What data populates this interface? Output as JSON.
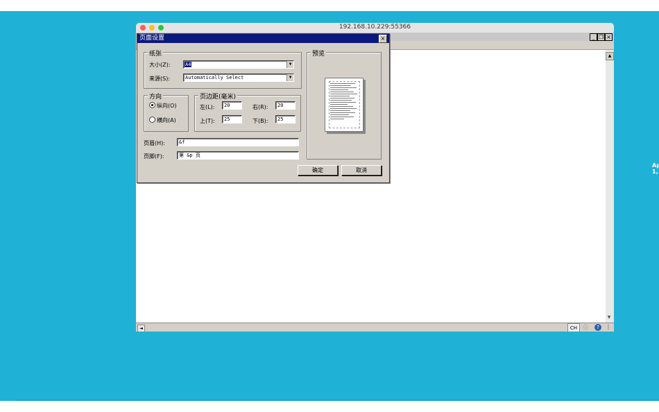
{
  "window": {
    "title": "192.168.10.229:55366",
    "min_glyph": "_",
    "restore_glyph": "❐",
    "close_glyph": "×"
  },
  "dialog": {
    "title": "页面设置",
    "close_glyph": "×",
    "paper": {
      "group_label": "纸张",
      "size_label": "大小(Z):",
      "size_value": "A4",
      "source_label": "来源(S):",
      "source_value": "Automatically Select"
    },
    "orientation": {
      "group_label": "方向",
      "portrait_label": "纵向(O)",
      "landscape_label": "横向(A)",
      "selected": "portrait"
    },
    "margins": {
      "group_label": "页边距(毫米)",
      "left_label": "左(L):",
      "left_value": "20",
      "right_label": "右(R):",
      "right_value": "20",
      "top_label": "上(T):",
      "top_value": "25",
      "bottom_label": "下(B):",
      "bottom_value": "25"
    },
    "header_label": "页眉(H):",
    "header_value": "&f",
    "footer_label": "页脚(F):",
    "footer_value": "第 &p 页",
    "preview_label": "预览",
    "ok_label": "确定",
    "cancel_label": "取消"
  },
  "statusbar": {
    "ime_label": "CH",
    "help_glyph": "?",
    "scroll_left_glyph": "◄",
    "scroll_up_glyph": "▲",
    "scroll_down_glyph": "▼",
    "lock_glyph": "🖨"
  },
  "desktop": {
    "edge_text_1": "Ap",
    "edge_text_2": "1,"
  },
  "colors": {
    "desktop": "#1fb2d6",
    "dialog_title": "#0a1a7a",
    "dialog_face": "#d4d0c8"
  }
}
